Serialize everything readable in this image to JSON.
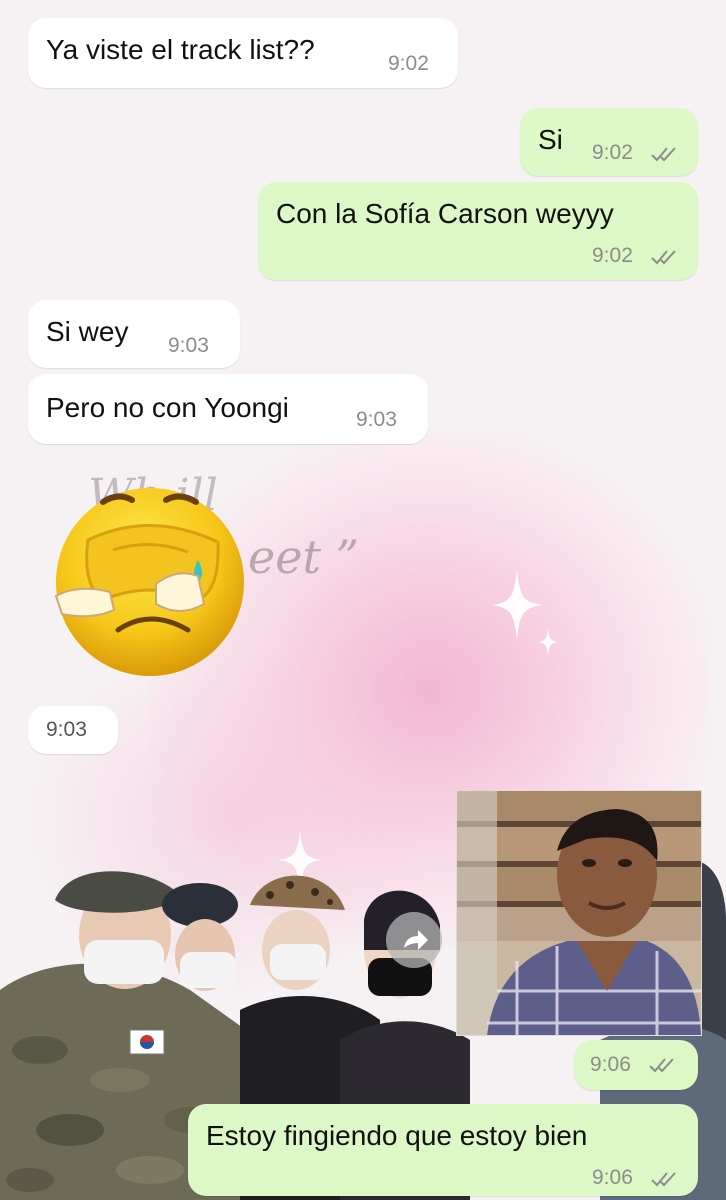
{
  "messages": [
    {
      "direction": "incoming",
      "text": "Ya viste el track list??",
      "time": "9:02"
    },
    {
      "direction": "outgoing",
      "text": "Si",
      "time": "9:02",
      "status": "read"
    },
    {
      "direction": "outgoing",
      "text": "Con la Sofía Carson weyyy",
      "time": "9:02",
      "status": "read"
    },
    {
      "direction": "incoming",
      "text": "Si wey",
      "time": "9:03"
    },
    {
      "direction": "incoming",
      "text": "Pero no con Yoongi",
      "time": "9:03"
    },
    {
      "direction": "incoming",
      "type": "sticker",
      "sticker": "crying-face-sticker",
      "time": "9:03"
    },
    {
      "direction": "outgoing",
      "type": "image",
      "time": "9:06",
      "status": "read"
    },
    {
      "direction": "outgoing",
      "text": "Estoy fingiendo que estoy bien",
      "time": "9:06",
      "status": "read"
    }
  ],
  "icons": {
    "read_receipt": "double-check-icon",
    "forward": "forward-arrow-icon"
  },
  "colors": {
    "incoming_bubble": "#ffffff",
    "outgoing_bubble": "#dcf8c6",
    "timestamp": "#8c8c8c",
    "wallpaper_pink": "#f2b7d2"
  }
}
